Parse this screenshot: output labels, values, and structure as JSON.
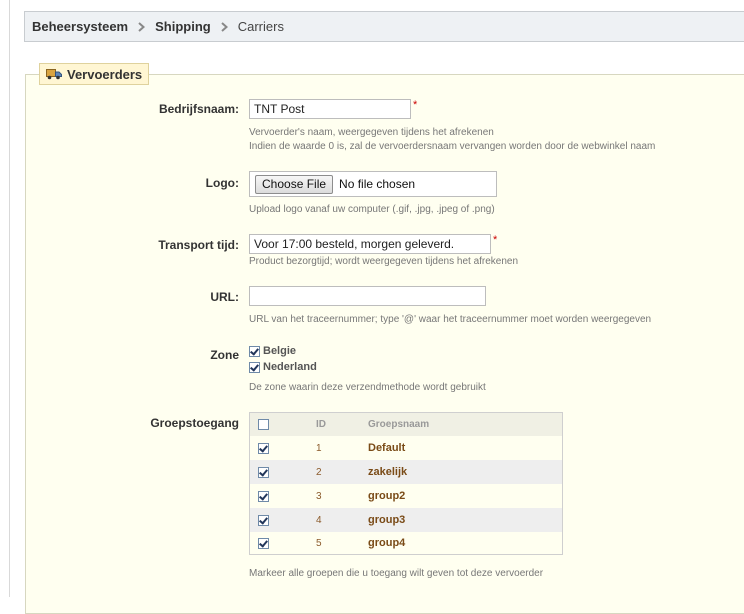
{
  "breadcrumb": {
    "items": [
      "Beheersysteem",
      "Shipping",
      "Carriers"
    ]
  },
  "fieldset": {
    "legend": "Vervoerders",
    "legend_icon": "truck-icon"
  },
  "form": {
    "company_name": {
      "label": "Bedrijfsnaam:",
      "value": "TNT Post",
      "required": "*",
      "hint_1": "Vervoerder's naam, weergegeven tijdens het afrekenen",
      "hint_2": "Indien de waarde 0 is, zal de vervoerdersnaam vervangen worden door de webwinkel naam"
    },
    "logo": {
      "label": "Logo:",
      "button": "Choose File",
      "file_status": "No file chosen",
      "hint": "Upload logo vanaf uw computer (.gif, .jpg, .jpeg of .png)"
    },
    "transport_time": {
      "label": "Transport tijd:",
      "value": "Voor 17:00 besteld, morgen geleverd.",
      "required": "*",
      "hint": "Product bezorgtijd; wordt weergegeven tijdens het afrekenen"
    },
    "url": {
      "label": "URL:",
      "value": "",
      "hint": "URL van het traceernummer; type '@' waar het traceernummer moet worden weergegeven"
    },
    "zone": {
      "label": "Zone",
      "items": [
        {
          "name": "Belgie",
          "checked": true
        },
        {
          "name": "Nederland",
          "checked": true
        }
      ],
      "hint": "De zone waarin deze verzendmethode wordt gebruikt"
    },
    "group_access": {
      "label": "Groepstoegang",
      "columns": [
        "ID",
        "Groepsnaam"
      ],
      "rows": [
        {
          "id": "1",
          "name": "Default",
          "checked": true
        },
        {
          "id": "2",
          "name": "zakelijk",
          "checked": true
        },
        {
          "id": "3",
          "name": "group2",
          "checked": true
        },
        {
          "id": "4",
          "name": "group3",
          "checked": true
        },
        {
          "id": "5",
          "name": "group4",
          "checked": true
        }
      ],
      "hint": "Markeer alle groepen die u toegang wilt geven tot deze vervoerder"
    }
  }
}
